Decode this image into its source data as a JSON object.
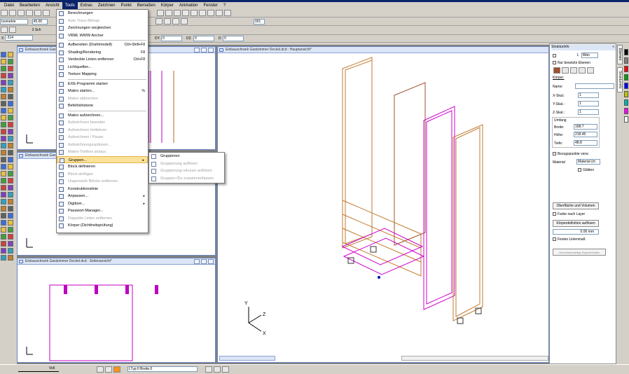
{
  "menubar": {
    "items": [
      "Datei",
      "Bearbeiten",
      "Ansicht",
      "Tools",
      "Extras",
      "Zeichnen",
      "Punkt",
      "Bemaßen",
      "Körper",
      "Animation",
      "Fenster",
      "?"
    ]
  },
  "toolbar": {
    "view_mode": "Isometrie",
    "angle": "45.00",
    "scale_label": "3 Sch",
    "coord_x_label": "X",
    "coord_x": "-314",
    "dy_label": "DY",
    "dy": "0",
    "dz_label": "DZ",
    "dz": "0",
    "d_label": "D",
    "d": "0",
    "dxf_label": "001"
  },
  "tools_menu": {
    "items": [
      {
        "label": "Berechnungen",
        "shortcut": "",
        "disabled": false
      },
      {
        "label": "Auto Trace Bitmap",
        "shortcut": "",
        "disabled": true
      },
      {
        "label": "Zeichnungen vergleichen",
        "shortcut": "",
        "disabled": false
      },
      {
        "label": "VRML WWW Ancher",
        "shortcut": "",
        "disabled": false
      },
      {
        "sep": true
      },
      {
        "label": "Aufbereiten (Drahtmodell)",
        "shortcut": "Ctrl+Shift+F8",
        "disabled": false
      },
      {
        "label": "Shading/Rendering",
        "shortcut": "F8",
        "disabled": false
      },
      {
        "label": "Verdeckte Linien entfernen",
        "shortcut": "Ctrl+F8",
        "disabled": false
      },
      {
        "label": "Lichtquellen...",
        "shortcut": "",
        "disabled": false
      },
      {
        "label": "Texture Mapping",
        "shortcut": "",
        "disabled": false
      },
      {
        "sep": true
      },
      {
        "label": "EXE-Programm starten",
        "shortcut": "",
        "disabled": false
      },
      {
        "label": "Makro starten...",
        "shortcut": "%",
        "disabled": false
      },
      {
        "label": "Makro abbrechen",
        "shortcut": "",
        "disabled": true
      },
      {
        "label": "Befehlshistorie",
        "shortcut": "",
        "disabled": false
      },
      {
        "sep": true
      },
      {
        "label": "Makro aufzeichnen...",
        "shortcut": "",
        "disabled": false
      },
      {
        "label": "Aufzeichnen beenden",
        "shortcut": "",
        "disabled": true
      },
      {
        "label": "Aufzeichnen fortfahren",
        "shortcut": "",
        "disabled": true
      },
      {
        "label": "Aufzeichnen / Pause",
        "shortcut": "",
        "disabled": true
      },
      {
        "label": "Aufzeichnungsoptionen...",
        "shortcut": "",
        "disabled": true
      },
      {
        "label": "Makro-Toolbox an/aus",
        "shortcut": "",
        "disabled": true
      },
      {
        "label": "Gruppen...",
        "shortcut": "",
        "disabled": false,
        "highlight": true,
        "submenu": true
      },
      {
        "label": "Block definieren",
        "shortcut": "",
        "disabled": false
      },
      {
        "label": "Block einfügen",
        "shortcut": "",
        "disabled": true
      },
      {
        "label": "Ungenutzte Blöcke entfernen",
        "shortcut": "",
        "disabled": true
      },
      {
        "label": "Konstruktionslinie",
        "shortcut": "",
        "disabled": false
      },
      {
        "label": "Anpassen...",
        "shortcut": "",
        "disabled": false,
        "submenu": true
      },
      {
        "label": "Digitizer...",
        "shortcut": "",
        "disabled": false,
        "submenu": true
      },
      {
        "label": "Passwort-Manager...",
        "shortcut": "",
        "disabled": false
      },
      {
        "label": "Doppelte Linien entfernen",
        "shortcut": "",
        "disabled": true
      },
      {
        "label": "Körper (Dichtheitsprüfung)",
        "shortcut": "",
        "disabled": false
      }
    ]
  },
  "gruppen_submenu": {
    "items": [
      {
        "label": "Gruppieren",
        "disabled": false
      },
      {
        "label": "Gruppierung auflösen",
        "disabled": true
      },
      {
        "label": "Gruppierung rekursiv auflösen",
        "disabled": true
      },
      {
        "label": "Gruppen-IDs zusammenfassen",
        "disabled": true
      }
    ]
  },
  "windows": {
    "front": {
      "title": "Einbauschrank Gastzimmer Deckel.dcd : Vorderansicht*"
    },
    "side": {
      "title": "Einbauschrank Gastzimmer Deckel.dcd : Seitenansicht*"
    },
    "top": {
      "title": "Einbauschrank Gastzimmer Deckel.dcd : Seitenansicht*"
    },
    "main": {
      "title": "Einbauschrank Gastzimmer Deckel.dcd : Hauptansicht*"
    }
  },
  "axes": {
    "y": "Y",
    "z": "Z",
    "x": "X"
  },
  "struktur": {
    "title": "Strukturinfo",
    "layer_count": "1",
    "layer_name": "Wän",
    "only_occupied_label": "Nur besetzte Ebenen",
    "koerper_label": "Körper:",
    "name_label": "Name:",
    "name_value": "",
    "xskal_label": "X-Skal.:",
    "xskal": "1",
    "yskal_label": "Y-Skal.:",
    "yskal": "1",
    "zskal_label": "Z-Skal.:",
    "zskal": "1",
    "umfang_label": "Umfang",
    "breite_label": "Breite:",
    "breite": "168.7",
    "hoehe_label": "Höhe:",
    "hoehe": "218.45",
    "tiefe_label": "Tiefe:",
    "tiefe": "48.8",
    "bezugspunkte_label": "Bezugspunkte verw.",
    "material_label": "Material",
    "material_value": "Material (m",
    "glaetten_label": "Glätten",
    "surface_button": "Oberfläche und Volumen",
    "farbe_label": "Farbe nach Layer",
    "koerperdef_button": "Körperdefinition auflösen",
    "linewidth": "0.00 mm",
    "feste_label": "Festes Linienmaß",
    "verschiedene_button": "Verschiedenartige Eigenschaften"
  },
  "side_tabs": [
    "Ebenen",
    "Strukturinfo"
  ],
  "statusbar": {
    "linestyle": "Voll",
    "ltyp": "LTyp:0",
    "breite": "Breite:0"
  },
  "palette_colors": [
    "#000000",
    "#7f7f7f",
    "#ff0000",
    "#00a000",
    "#0000ff",
    "#c0c000",
    "#00b0b0",
    "#ff00ff",
    "#ffffff"
  ]
}
